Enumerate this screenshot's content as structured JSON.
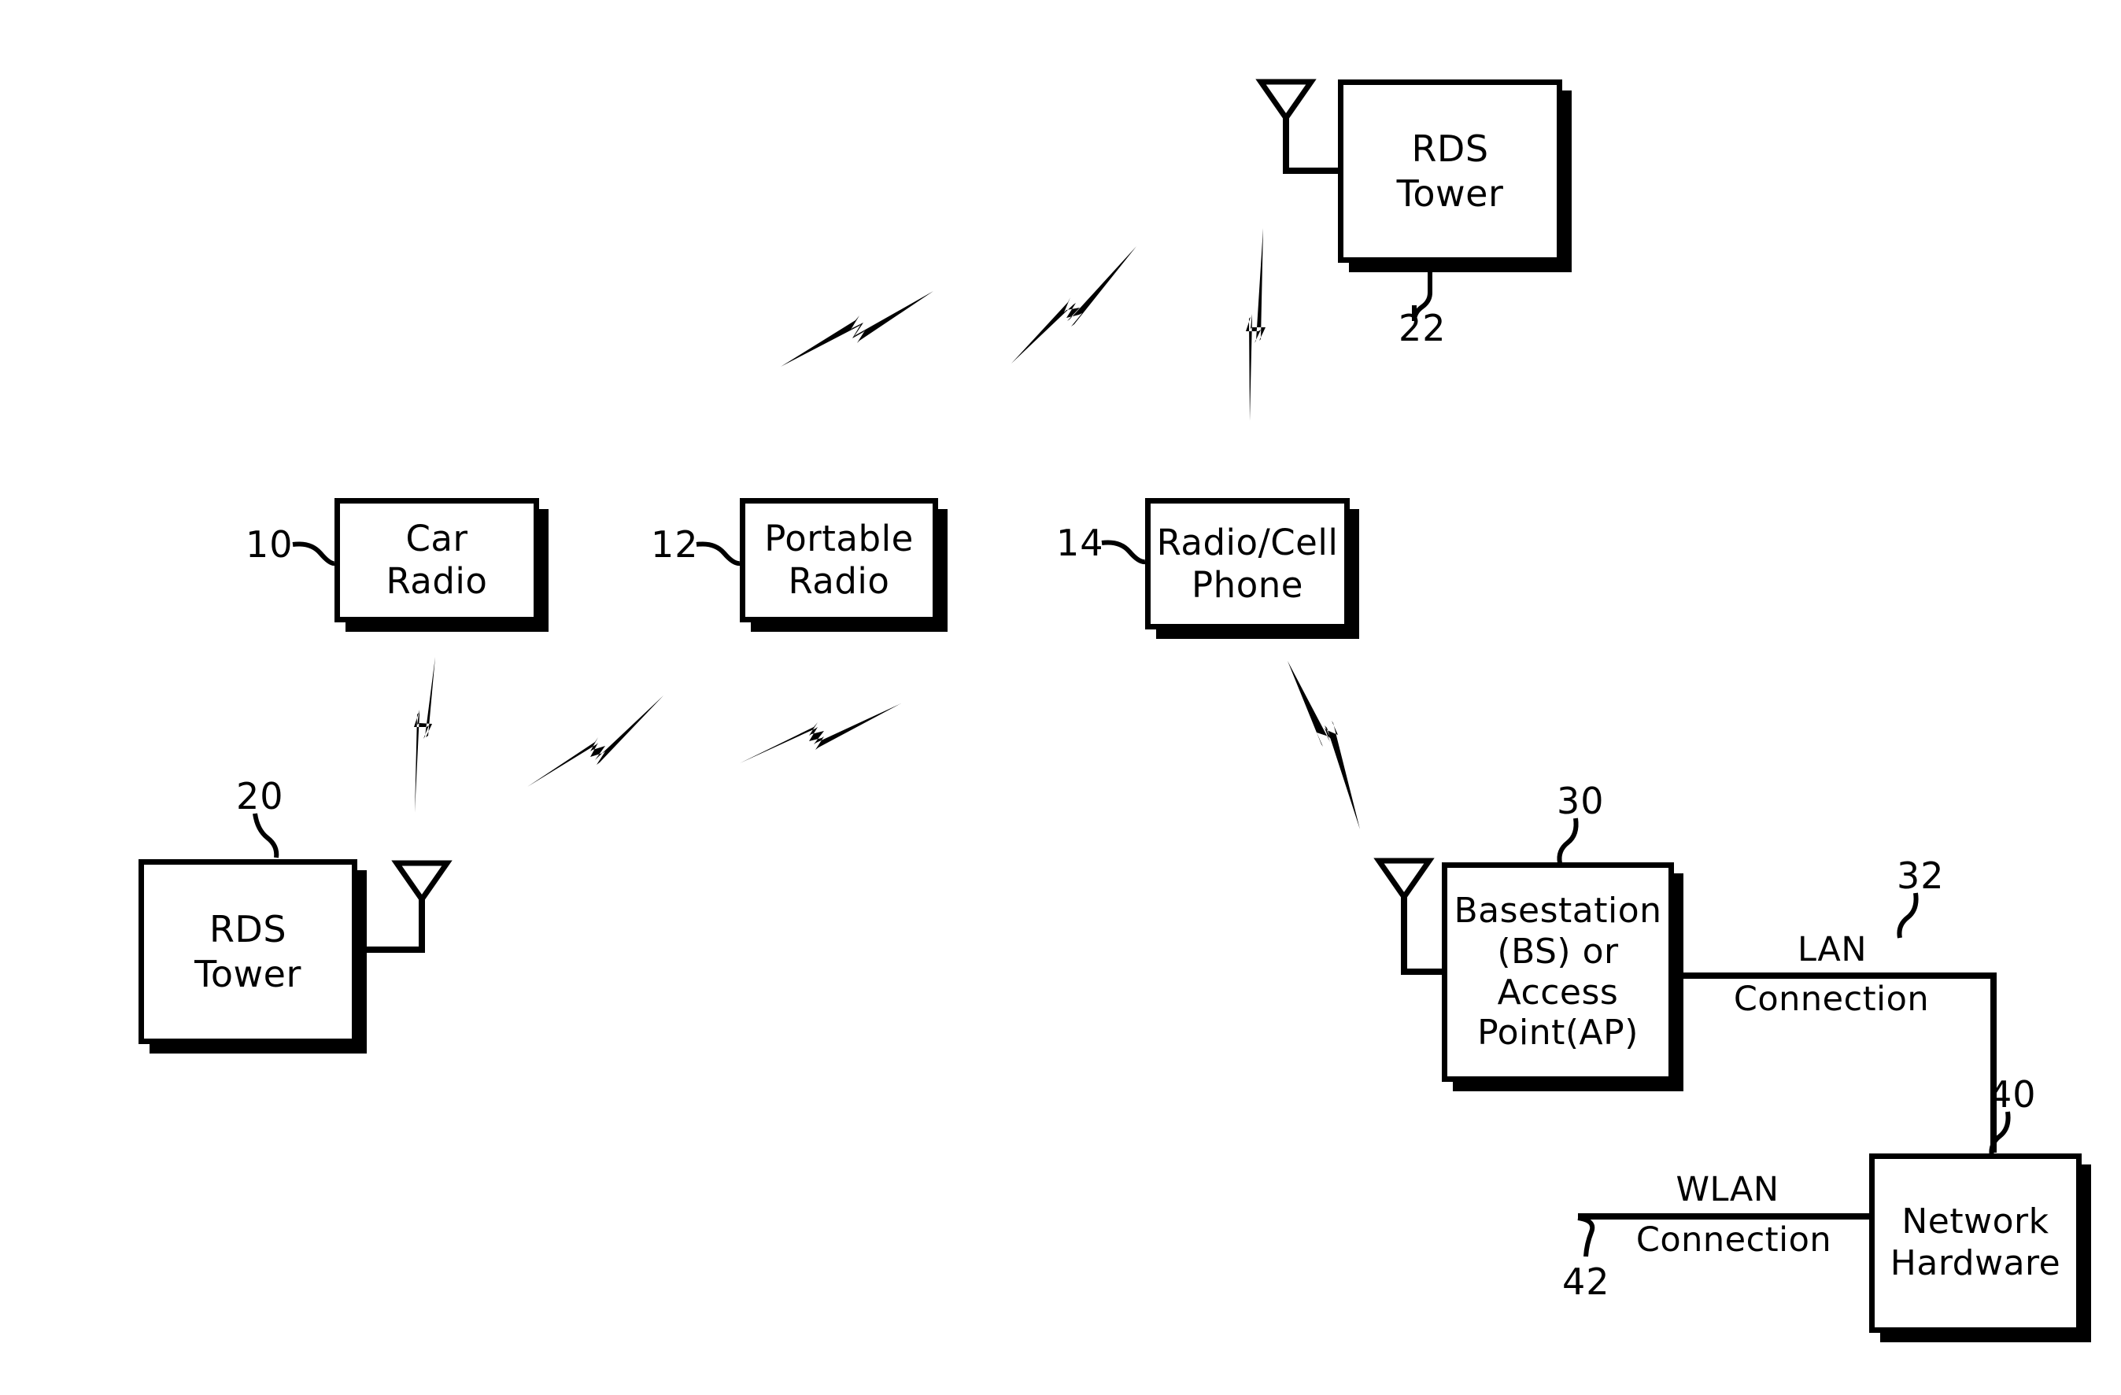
{
  "figure": {
    "type": "patent-block-diagram",
    "background": "#ffffff",
    "ink_color": "#000000"
  },
  "nodes": {
    "rds_tower_top": {
      "lines": [
        "RDS",
        "Tower"
      ],
      "ref": "22",
      "antenna": "antenna-icon"
    },
    "car_radio": {
      "lines": [
        "Car",
        "Radio"
      ],
      "ref": "10"
    },
    "portable_radio": {
      "lines": [
        "Portable",
        "Radio"
      ],
      "ref": "12"
    },
    "radio_cell_phone": {
      "lines": [
        "Radio/Cell",
        "Phone"
      ],
      "ref": "14"
    },
    "rds_tower_bottom": {
      "lines": [
        "RDS",
        "Tower"
      ],
      "ref": "20",
      "antenna": "antenna-icon"
    },
    "basestation": {
      "lines": [
        "Basestation",
        "(BS) or",
        "Access",
        "Point(AP)"
      ],
      "ref": "30",
      "antenna": "antenna-icon"
    },
    "network_hardware": {
      "lines": [
        "Network",
        "Hardware"
      ],
      "ref": "40"
    }
  },
  "connections": {
    "lan": {
      "label_line1": "LAN",
      "label_line2": "Connection",
      "ref": "32"
    },
    "wlan": {
      "label_line1": "WLAN",
      "label_line2": "Connection",
      "ref": "42"
    }
  },
  "wireless_links": [
    {
      "name": "bolt-top-left",
      "from": "portable-radio-area",
      "to": "rds-tower-top"
    },
    {
      "name": "bolt-top-middle",
      "from": "radio-cell-area",
      "to": "rds-tower-top"
    },
    {
      "name": "bolt-top-right",
      "from": "radio-cell-phone",
      "to": "rds-tower-top"
    },
    {
      "name": "bolt-car-radio",
      "from": "car-radio",
      "to": "rds-tower-bottom"
    },
    {
      "name": "bolt-lower-mid",
      "from": "portable-radio",
      "to": "rds-tower-bottom"
    },
    {
      "name": "bolt-lower-right",
      "from": "radio-cell-phone",
      "to": "rds-tower-bottom"
    },
    {
      "name": "bolt-cell-to-bs",
      "from": "radio-cell-phone",
      "to": "basestation"
    }
  ]
}
